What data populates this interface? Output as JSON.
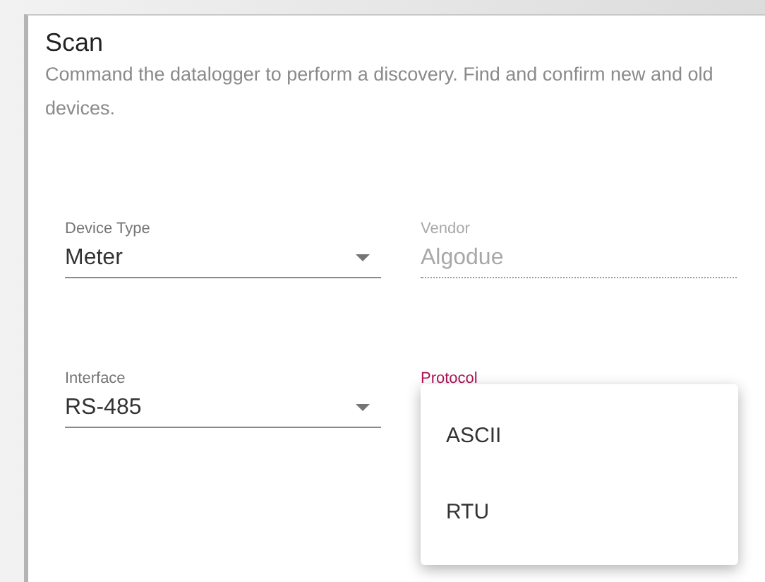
{
  "dialog": {
    "title": "Scan",
    "description": "Command the datalogger to perform a discovery. Find and confirm new and old devices."
  },
  "fields": [
    {
      "label": "Device Type",
      "value": "Meter",
      "kind": "select",
      "disabled": false,
      "focused": false
    },
    {
      "label": "Vendor",
      "value": "Algodue",
      "kind": "text",
      "disabled": true,
      "focused": false
    },
    {
      "label": "Interface",
      "value": "RS-485",
      "kind": "select",
      "disabled": false,
      "focused": false
    },
    {
      "label": "Protocol",
      "disabled": false,
      "focused": true
    }
  ],
  "menu": {
    "items": [
      {
        "label": "ASCII"
      },
      {
        "label": "RTU"
      }
    ]
  }
}
